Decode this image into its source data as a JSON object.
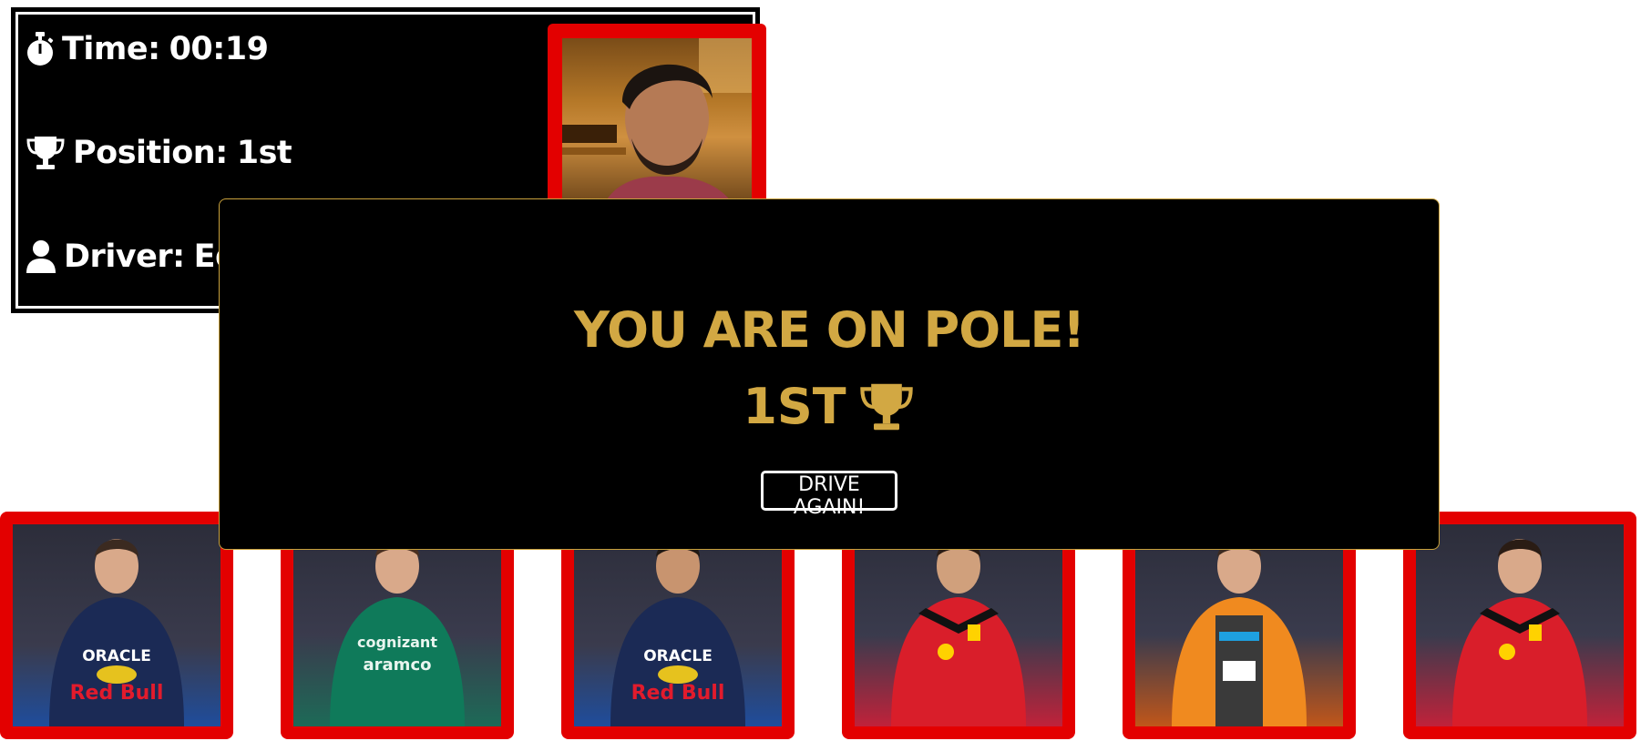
{
  "stats": {
    "time_label": "Time:",
    "time_value": "00:19",
    "position_label": "Position:",
    "position_value": "1st",
    "driver_label": "Driver:",
    "driver_value": "Edoa",
    "icons": [
      "stopwatch-icon",
      "trophy-icon",
      "user-icon"
    ]
  },
  "modal": {
    "title": "YOU ARE ON POLE!",
    "result": "1ST",
    "result_icon": "trophy-icon",
    "button_label": "DRIVE AGAIN!"
  },
  "drivers": [
    {
      "suit_color": "#1b2a55",
      "accent": "#e21b2c",
      "text": [
        "ORACLE",
        "Red Bull"
      ]
    },
    {
      "suit_color": "#0f7a5a",
      "accent": "#cfe9e0",
      "text": [
        "cognizant",
        "aramco"
      ]
    },
    {
      "suit_color": "#1b2a55",
      "accent": "#e21b2c",
      "text": [
        "ORACLE",
        "Red Bull"
      ]
    },
    {
      "suit_color": "#d91e2a",
      "accent": "#111111",
      "text": []
    },
    {
      "suit_color": "#f08a1f",
      "accent": "#2f2f2f",
      "text": []
    },
    {
      "suit_color": "#d91e2a",
      "accent": "#111111",
      "text": []
    }
  ],
  "colors": {
    "card_border": "#e30000",
    "gold": "#d2a843",
    "panel_bg": "#000000"
  }
}
